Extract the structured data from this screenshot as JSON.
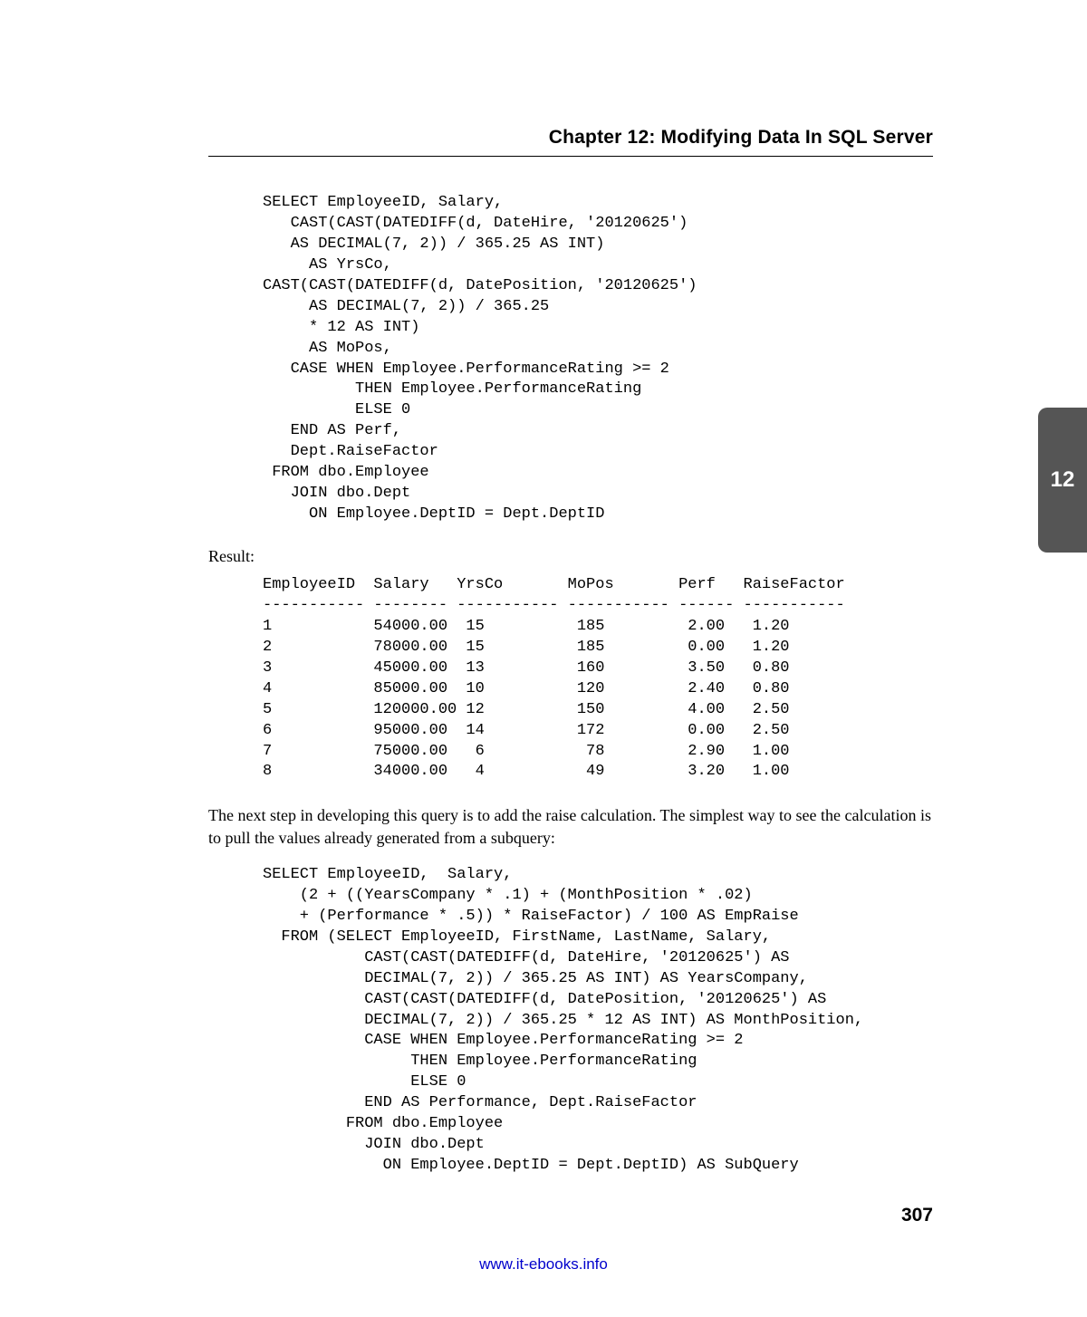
{
  "chapter_title": "Chapter 12: Modifying Data In SQL Server",
  "tab_label": "12",
  "code_block_1": "SELECT EmployeeID, Salary,\n   CAST(CAST(DATEDIFF(d, DateHire, '20120625')\n   AS DECIMAL(7, 2)) / 365.25 AS INT)\n     AS YrsCo,\nCAST(CAST(DATEDIFF(d, DatePosition, '20120625')\n     AS DECIMAL(7, 2)) / 365.25\n     * 12 AS INT)\n     AS MoPos,\n   CASE WHEN Employee.PerformanceRating >= 2\n          THEN Employee.PerformanceRating\n          ELSE 0\n   END AS Perf,\n   Dept.RaiseFactor\n FROM dbo.Employee\n   JOIN dbo.Dept\n     ON Employee.DeptID = Dept.DeptID",
  "result_label": "Result:",
  "result_table": "EmployeeID  Salary   YrsCo       MoPos       Perf   RaiseFactor\n----------- -------- ----------- ----------- ------ -----------\n1           54000.00  15          185         2.00   1.20\n2           78000.00  15          185         0.00   1.20\n3           45000.00  13          160         3.50   0.80\n4           85000.00  10          120         2.40   0.80\n5           120000.00 12          150         4.00   2.50\n6           95000.00  14          172         0.00   2.50\n7           75000.00   6           78         2.90   1.00\n8           34000.00   4           49         3.20   1.00",
  "body_paragraph": "The next step in developing this query is to add the raise calculation. The simplest way to see the calculation is to pull the values already generated from a subquery:",
  "code_block_2": "SELECT EmployeeID,  Salary,\n    (2 + ((YearsCompany * .1) + (MonthPosition * .02)\n    + (Performance * .5)) * RaiseFactor) / 100 AS EmpRaise\n  FROM (SELECT EmployeeID, FirstName, LastName, Salary,\n           CAST(CAST(DATEDIFF(d, DateHire, '20120625') AS\n           DECIMAL(7, 2)) / 365.25 AS INT) AS YearsCompany,\n           CAST(CAST(DATEDIFF(d, DatePosition, '20120625') AS\n           DECIMAL(7, 2)) / 365.25 * 12 AS INT) AS MonthPosition,\n           CASE WHEN Employee.PerformanceRating >= 2\n                THEN Employee.PerformanceRating\n                ELSE 0\n           END AS Performance, Dept.RaiseFactor\n         FROM dbo.Employee\n           JOIN dbo.Dept\n             ON Employee.DeptID = Dept.DeptID) AS SubQuery",
  "page_number": "307",
  "footer_link_text": "www.it-ebooks.info",
  "footer_link_href": "http://www.it-ebooks.info"
}
